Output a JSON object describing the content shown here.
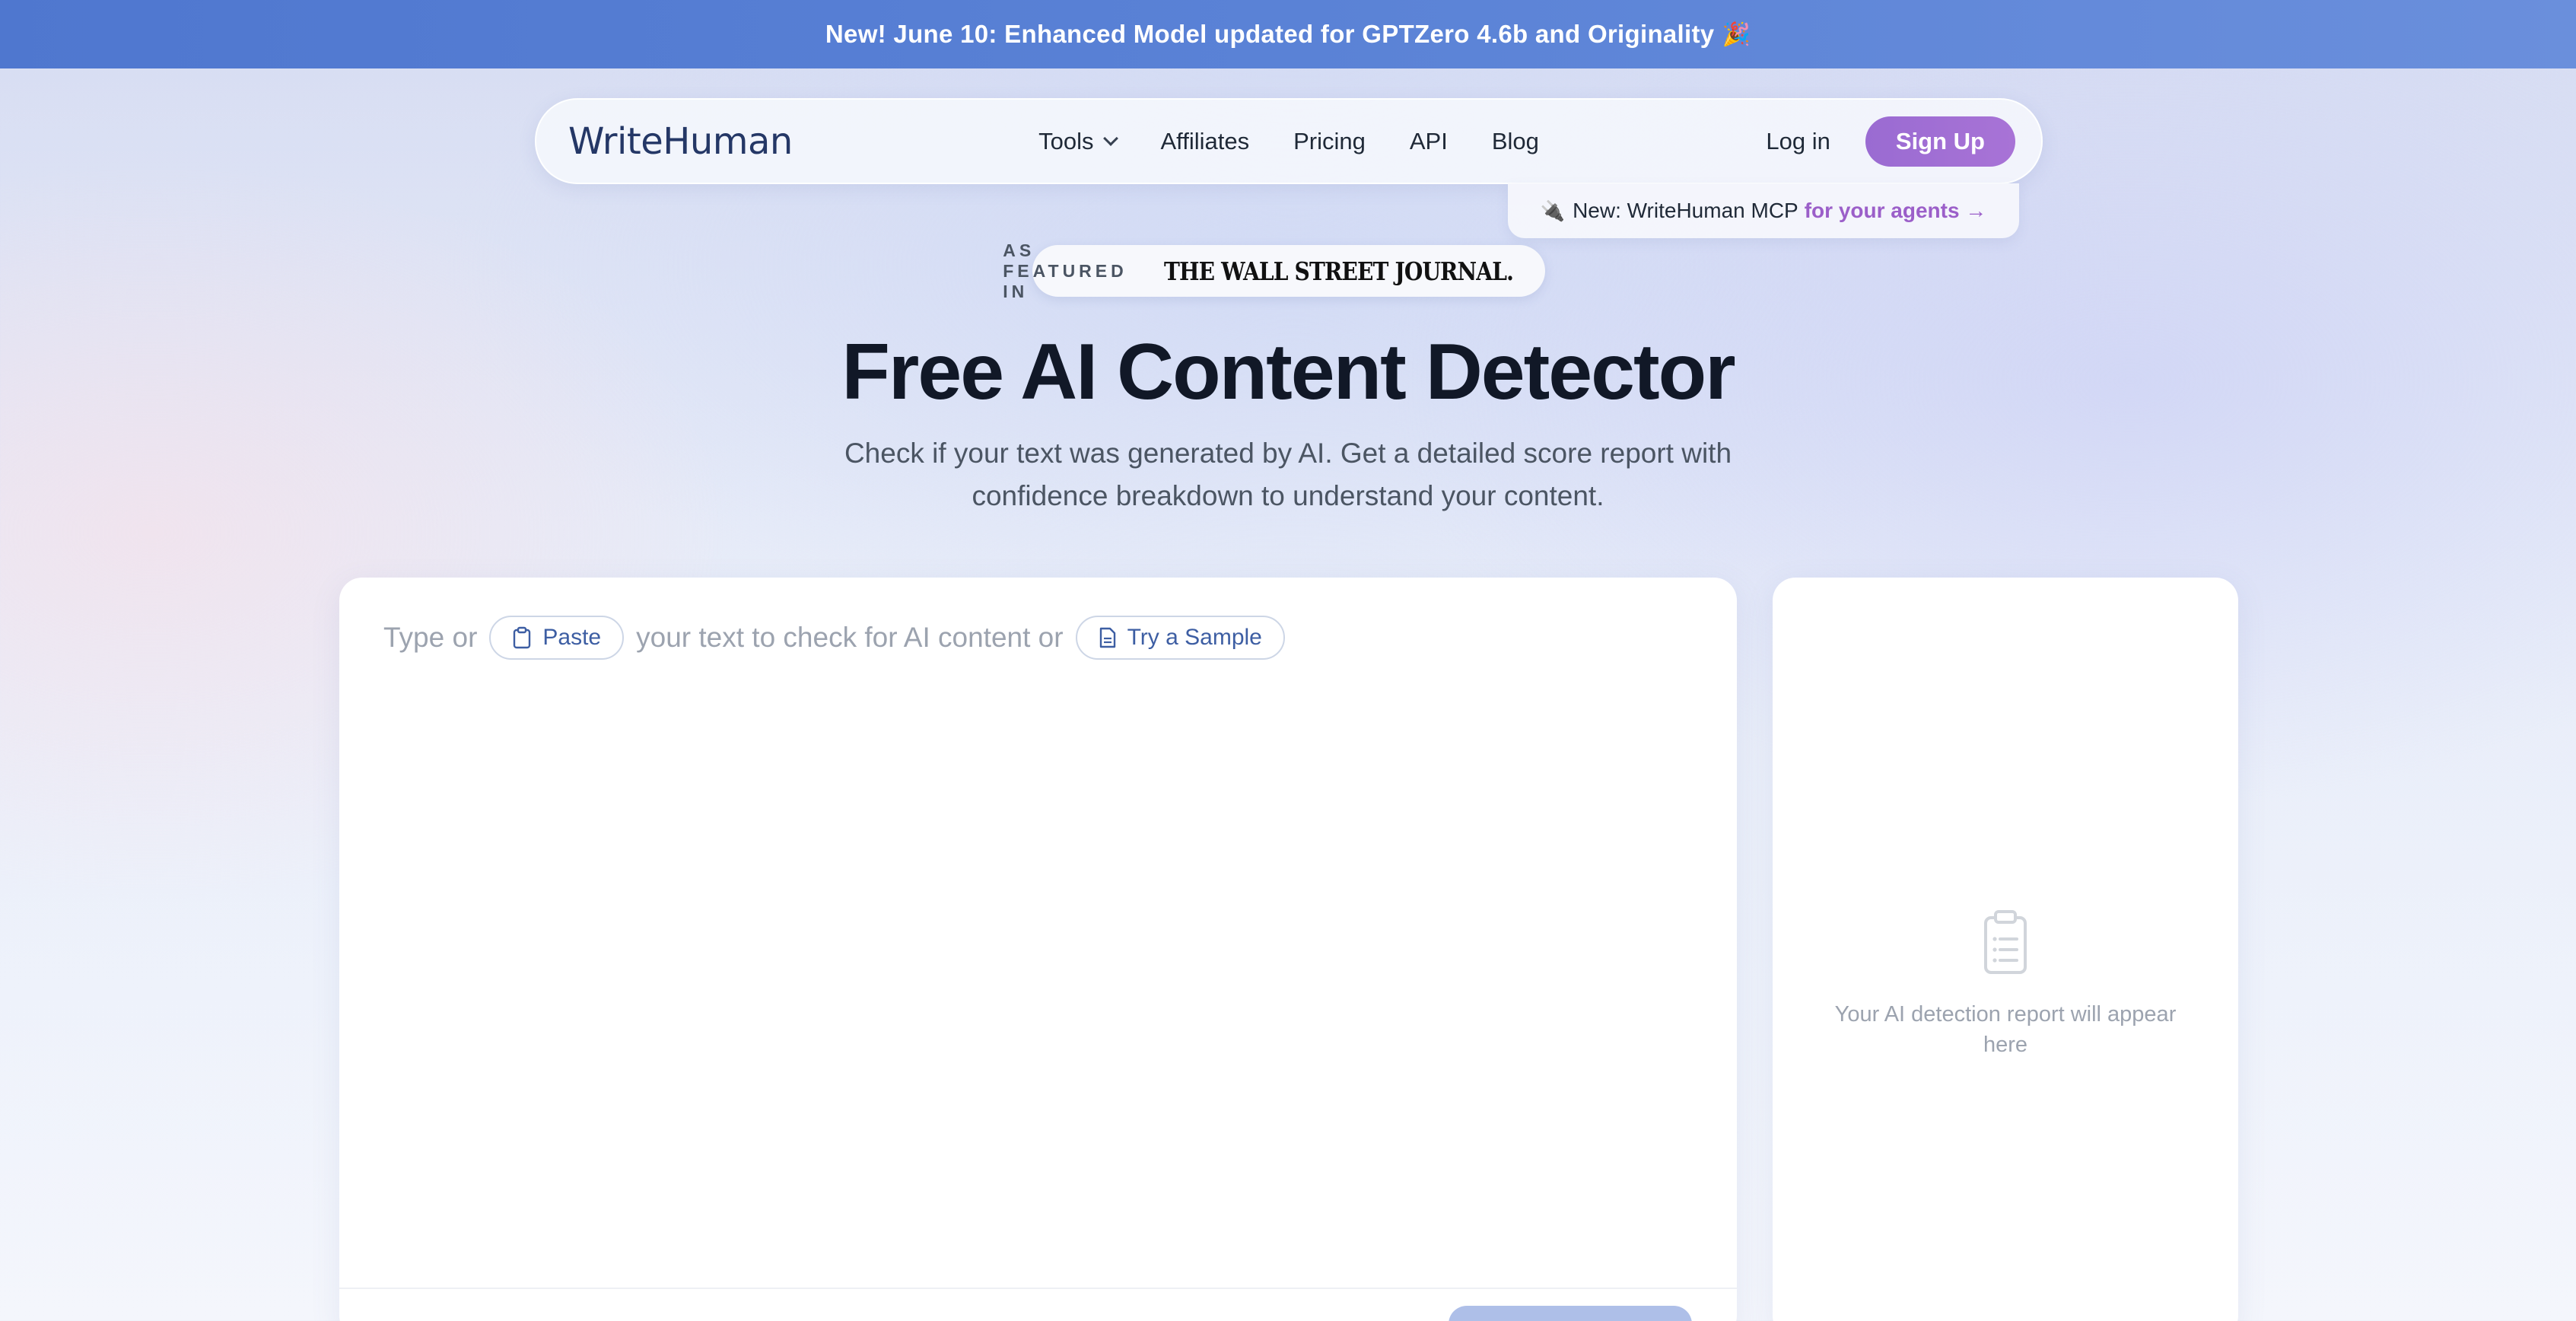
{
  "banner": {
    "text": "New! June 10: Enhanced Model updated for GPTZero 4.6b and Originality",
    "emoji": "🎉"
  },
  "nav": {
    "logo": "WriteHuman",
    "links": [
      "Tools",
      "Affiliates",
      "Pricing",
      "API",
      "Blog"
    ],
    "login": "Log in",
    "signup": "Sign Up"
  },
  "mcp": {
    "icon": "🔌",
    "text": "New: WriteHuman MCP",
    "accent": "for your agents →"
  },
  "featured": {
    "label": "AS FEATURED IN",
    "publication": "THE WALL STREET JOURNAL."
  },
  "hero": {
    "title": "Free AI Content Detector",
    "subtitle": "Check if your text was generated by AI. Get a detailed score report with confidence breakdown to understand your content."
  },
  "editor": {
    "prompt_start": "Type or",
    "paste_label": "Paste",
    "prompt_middle": "your text to check for AI content or",
    "sample_label": "Try a Sample"
  },
  "report": {
    "placeholder": "Your AI detection report will appear here"
  },
  "colors": {
    "banner": "#4f77cf",
    "signup": "#9a6bd2",
    "accent_purple": "#9b5fc9",
    "chip_text": "#3d5ea3"
  }
}
